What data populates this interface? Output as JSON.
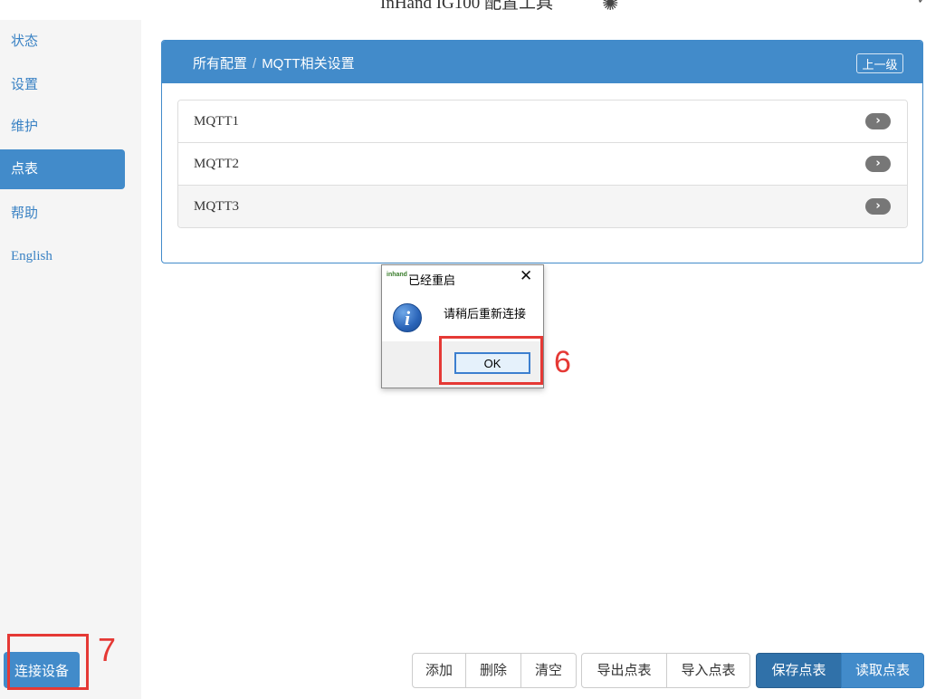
{
  "window": {
    "title": "InHand IG100 配置工具"
  },
  "sidebar": {
    "items": [
      {
        "label": "状态"
      },
      {
        "label": "设置"
      },
      {
        "label": "维护"
      },
      {
        "label": "点表"
      },
      {
        "label": "帮助"
      },
      {
        "label": "English"
      }
    ],
    "active": "点表",
    "connect_label": "连接设备"
  },
  "panel": {
    "breadcrumb": {
      "root": "所有配置",
      "separator": "/",
      "current": "MQTT相关设置"
    },
    "up_label": "上一级",
    "rows": [
      {
        "label": "MQTT1"
      },
      {
        "label": "MQTT2"
      },
      {
        "label": "MQTT3"
      }
    ],
    "chevron": "›"
  },
  "dialog": {
    "logo": "inhand",
    "title": "已经重启",
    "close": "✕",
    "icon": "i",
    "message": "请稍后重新连接",
    "ok_label": "OK"
  },
  "annotations": {
    "step6": "6",
    "step7": "7",
    "color": "#e53935"
  },
  "toolbar": {
    "add": "添加",
    "delete": "删除",
    "clear": "清空",
    "export": "导出点表",
    "import": "导入点表",
    "save": "保存点表",
    "read": "读取点表"
  },
  "colors": {
    "primary": "#428bca",
    "sidebar_bg": "#f5f5f5"
  }
}
